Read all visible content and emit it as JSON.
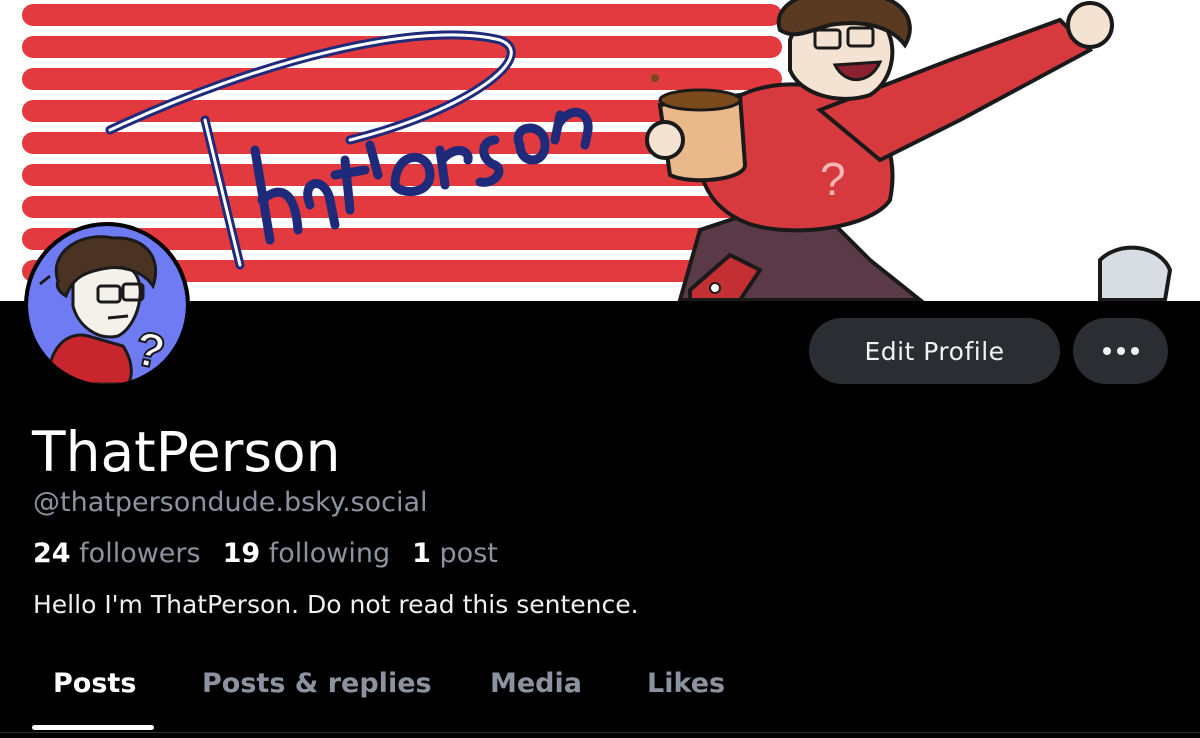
{
  "banner": {
    "title_art": "ThatPerson"
  },
  "profile": {
    "display_name": "ThatPerson",
    "handle": "@thatpersondude.bsky.social",
    "followers_count": "24",
    "followers_label": "followers",
    "following_count": "19",
    "following_label": "following",
    "posts_count": "1",
    "posts_label": "post",
    "bio": "Hello I'm ThatPerson. Do not read this sentence."
  },
  "actions": {
    "edit_label": "Edit Profile",
    "more_icon": "ellipsis-icon"
  },
  "tabs": [
    {
      "label": "Posts",
      "active": true
    },
    {
      "label": "Posts & replies",
      "active": false
    },
    {
      "label": "Media",
      "active": false
    },
    {
      "label": "Likes",
      "active": false
    }
  ],
  "colors": {
    "banner_red": "#e23a3f",
    "background": "#000000",
    "button_bg": "#2a2d31",
    "muted_text": "#8b93a0",
    "avatar_bg": "#6f7bf2"
  }
}
